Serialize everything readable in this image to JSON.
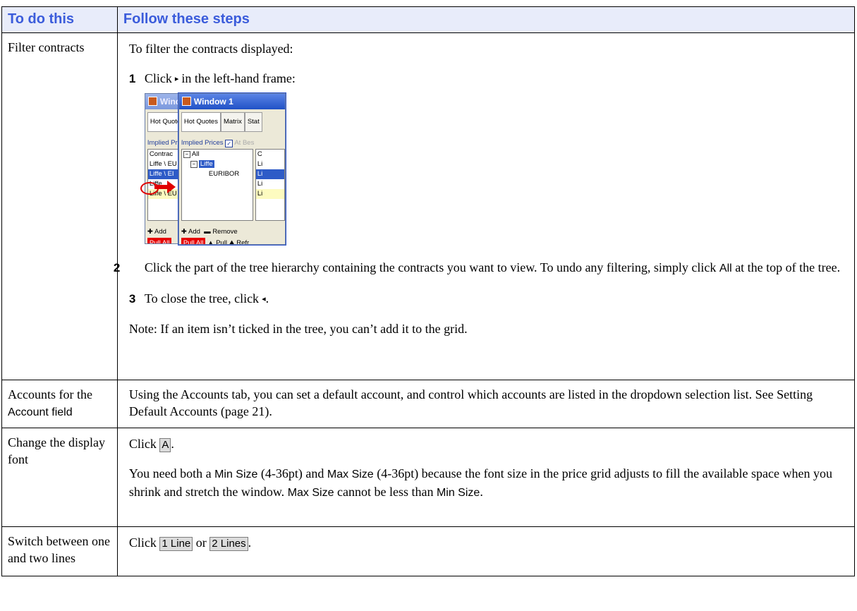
{
  "headers": {
    "col1": "To do this",
    "col2": "Follow these steps"
  },
  "rows": {
    "filter": {
      "label": "Filter contracts",
      "intro": "To filter the contracts displayed:",
      "step1": {
        "num": "1",
        "pre": "Click",
        "glyph": "▸",
        "post": "in the left-hand frame:"
      },
      "step2": {
        "num": "2",
        "pre": "Click the part of the tree hierarchy containing the contracts you want to view. To undo any filtering, simply click",
        "ui": "All",
        "post": "at the top of the tree."
      },
      "step3": {
        "num": "3",
        "pre": "To close the tree, click",
        "glyph": "◂",
        "post": "."
      },
      "note": "Note: If an item isn’t ticked in the tree, you can’t add it to the grid."
    },
    "accounts": {
      "label_pre": "Accounts for the",
      "label_ui": "Account field",
      "text": "Using the Accounts tab, you can set a default account, and control which accounts are listed in the dropdown selection list. See Setting Default Accounts (page 21)."
    },
    "font": {
      "label": "Change the display font",
      "click": "Click",
      "btn": "A",
      "dot": ".",
      "t1": "You need both a",
      "min": "Min Size",
      "t2": "(4-36pt) and",
      "max": "Max Size",
      "t3": "(4-36pt) because the font size in the price grid adjusts to fill the available space when you shrink and stretch the window.",
      "max2": "Max Size",
      "t4": "cannot be less than",
      "min2": "Min Size",
      "t5": "."
    },
    "lines": {
      "label": "Switch between one and two lines",
      "click": "Click",
      "btn1": "1 Line",
      "or": "or",
      "btn2": "2 Lines",
      "dot": "."
    }
  },
  "screenshot": {
    "back_title": "Wind",
    "front_title": "Window 1",
    "back_tab": "Hot Quote",
    "tabs": [
      "Hot Quotes",
      "Matrix",
      "Stat"
    ],
    "back_implied": "Implied Pr",
    "implied": "Implied Prices",
    "at_best": "At Bes",
    "back_list": [
      "Contrac",
      "Liffe \\ EU",
      "Liffe \\ EI",
      "Liffe",
      "Liffe \\ EU"
    ],
    "tree": [
      "All",
      "Liffe",
      "EURIBOR"
    ],
    "right_list": [
      "C",
      "Li",
      "Li",
      "Li",
      "Li"
    ],
    "add": "Add",
    "remove": "Remove",
    "pull_all": "Pull All",
    "pull": "Pull",
    "refresh": "Refr",
    "back_add": "Add"
  }
}
